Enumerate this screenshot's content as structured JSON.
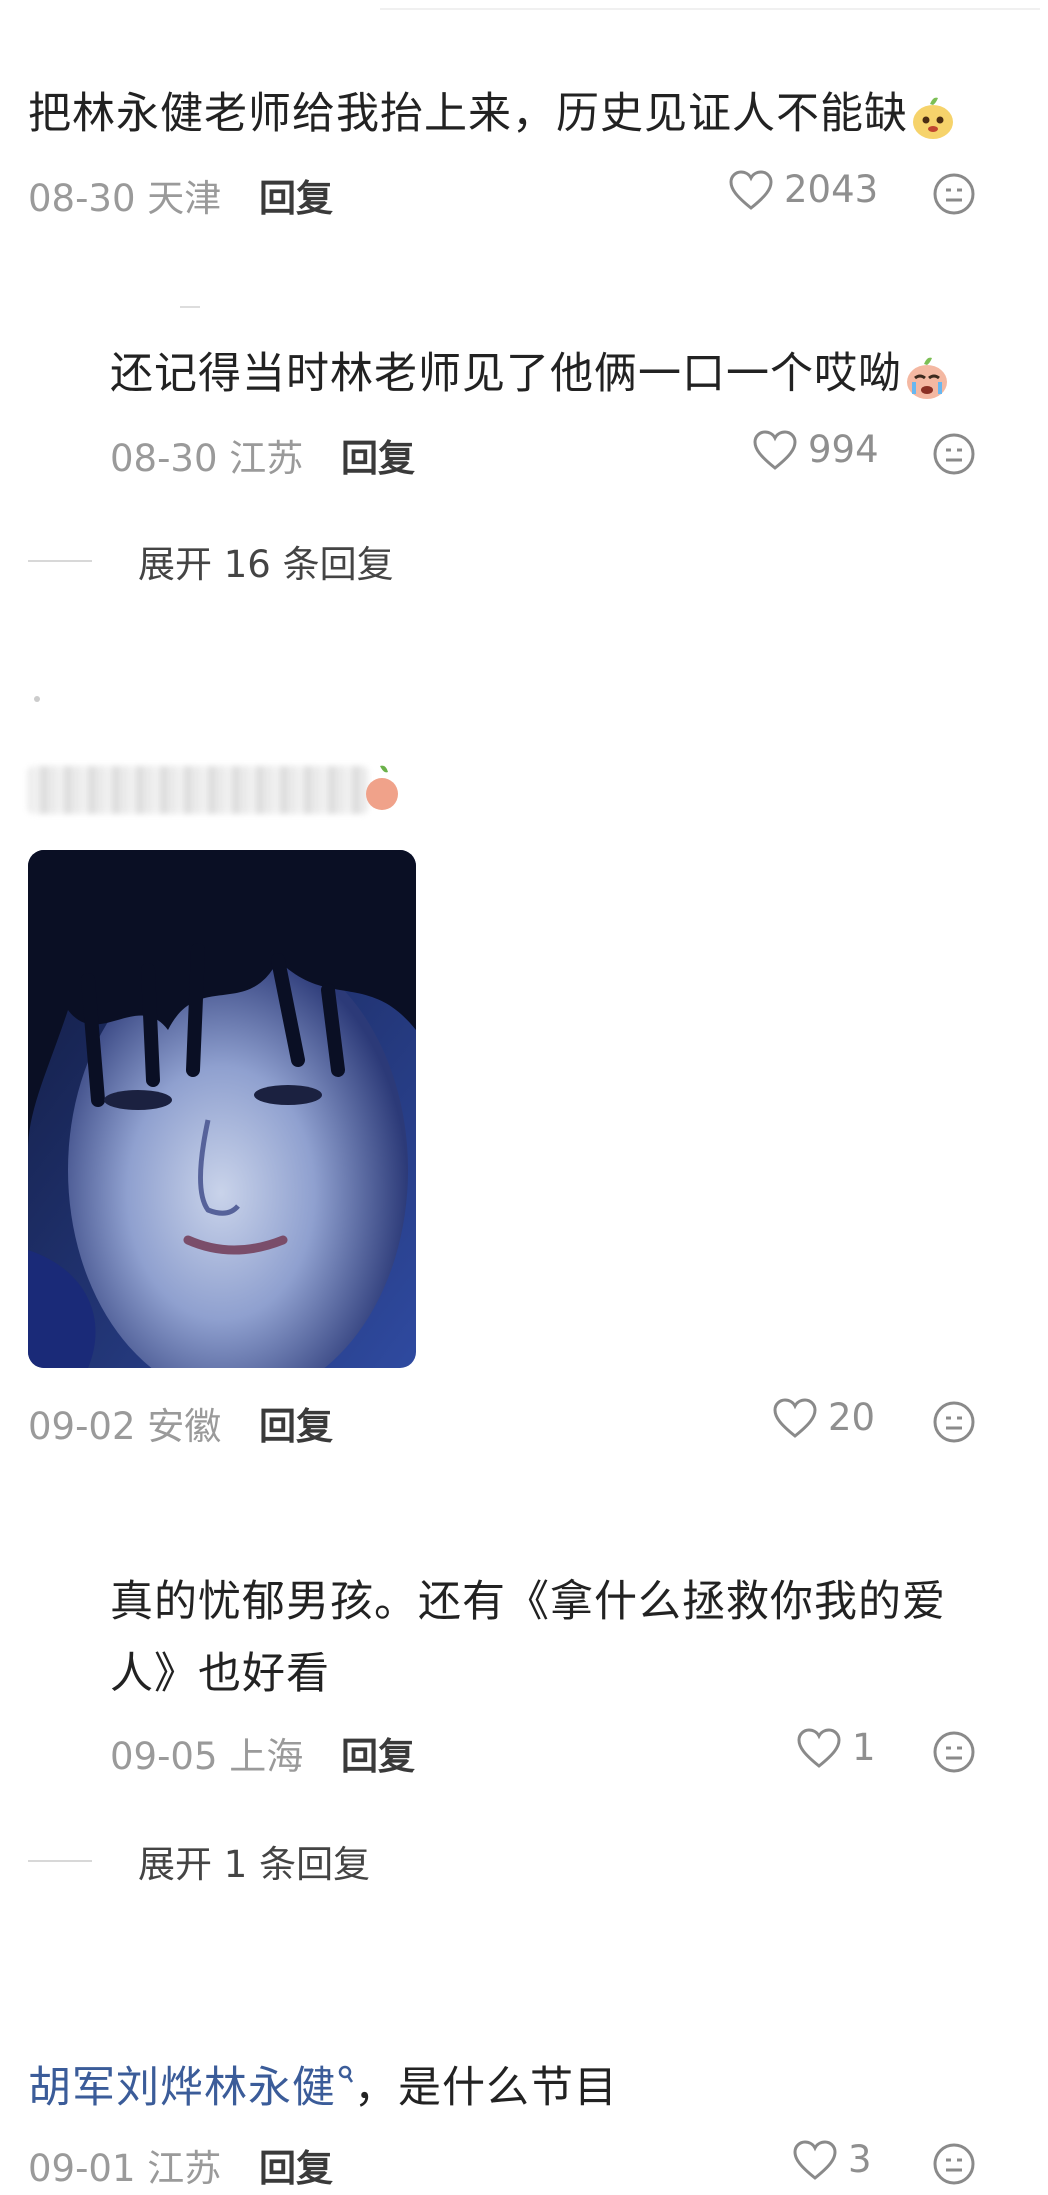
{
  "comments": [
    {
      "text": "把林永健老师给我抬上来，历史见证人不能缺",
      "date": "08-30",
      "location": "天津",
      "reply_label": "回复",
      "likes": "2043",
      "emoji": "pear-smile-emoji"
    },
    {
      "text": "还记得当时林老师见了他俩一口一个哎呦",
      "date": "08-30",
      "location": "江苏",
      "reply_label": "回复",
      "likes": "994",
      "emoji": "crying-emoji"
    },
    {
      "expand_label": "展开 16 条回复"
    },
    {
      "has_photo": true,
      "date": "09-02",
      "location": "安徽",
      "reply_label": "回复",
      "likes": "20"
    },
    {
      "text_line1": "真的忧郁男孩。还有《拿什么拯救你我的爱",
      "text_line2": "人》也好看",
      "date": "09-05",
      "location": "上海",
      "reply_label": "回复",
      "likes": "1"
    },
    {
      "expand_label": "展开 1 条回复"
    },
    {
      "text_highlight": "胡军刘烨林永健",
      "text_rest": "，是什么节目",
      "date": "09-01",
      "location": "江苏",
      "reply_label": "回复",
      "likes": "3"
    }
  ],
  "icons": {
    "like": "heart-outline-icon",
    "more": "face-neutral-icon",
    "search_pin": "search-pin-icon"
  },
  "colors": {
    "link": "#3b5c99",
    "meta": "#9a9a9a",
    "text": "#222222"
  }
}
